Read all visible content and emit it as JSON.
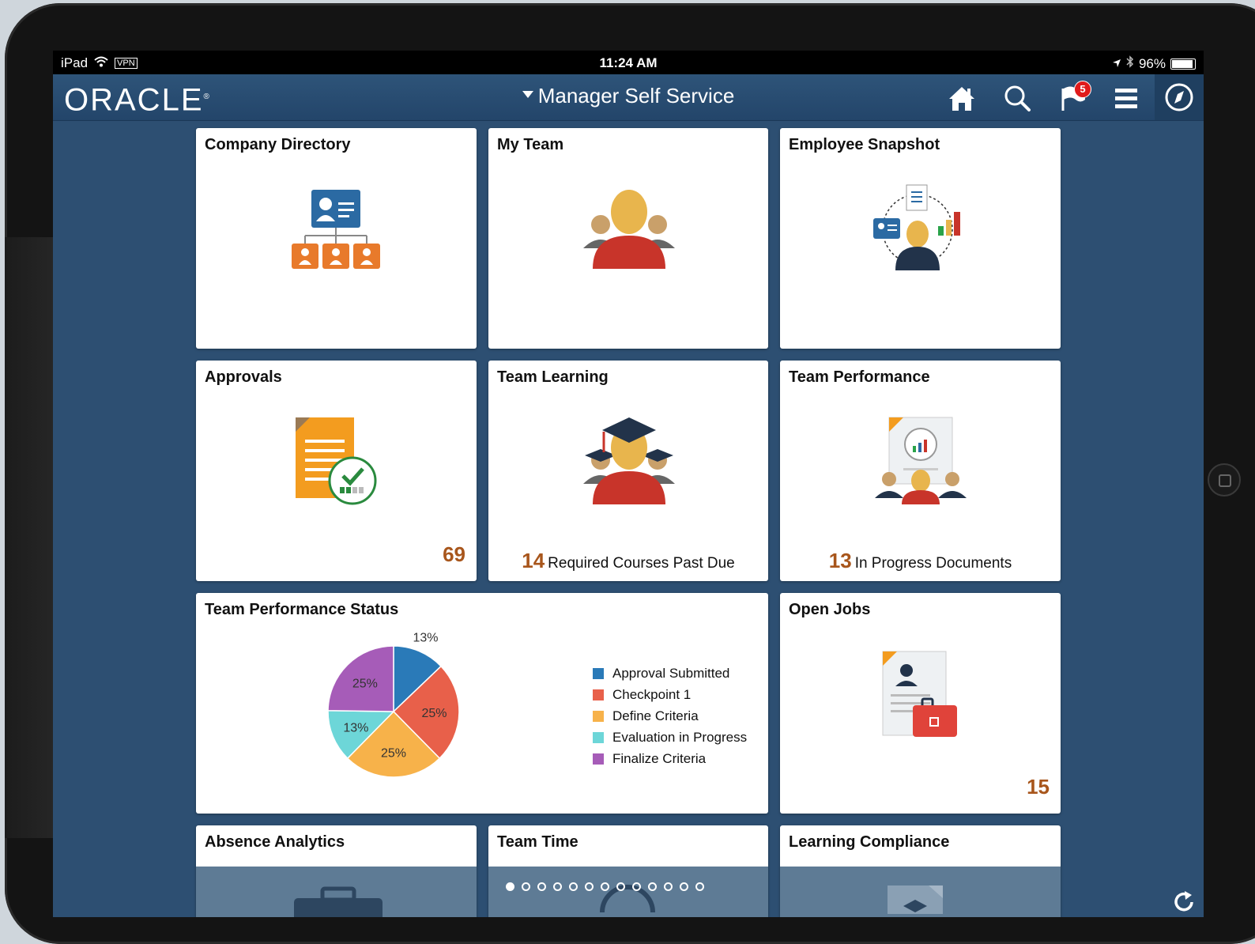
{
  "status_bar": {
    "device": "iPad",
    "vpn": "VPN",
    "time": "11:24 AM",
    "battery": "96%"
  },
  "header": {
    "logo": "ORACLE",
    "title": "Manager Self Service",
    "notification_count": "5"
  },
  "tiles": {
    "company_directory": {
      "title": "Company Directory"
    },
    "my_team": {
      "title": "My Team"
    },
    "employee_snapshot": {
      "title": "Employee Snapshot"
    },
    "approvals": {
      "title": "Approvals",
      "count": "69"
    },
    "team_learning": {
      "title": "Team Learning",
      "count": "14",
      "label": "Required Courses Past Due"
    },
    "team_performance": {
      "title": "Team Performance",
      "count": "13",
      "label": "In Progress Documents"
    },
    "team_performance_status": {
      "title": "Team Performance Status"
    },
    "open_jobs": {
      "title": "Open Jobs",
      "count": "15"
    },
    "absence_analytics": {
      "title": "Absence Analytics"
    },
    "team_time": {
      "title": "Team Time"
    },
    "learning_compliance": {
      "title": "Learning Compliance"
    }
  },
  "chart_data": {
    "type": "pie",
    "title": "Team Performance Status",
    "categories": [
      "Approval Submitted",
      "Checkpoint 1",
      "Define Criteria",
      "Evaluation in Progress",
      "Finalize Criteria"
    ],
    "values": [
      13,
      25,
      25,
      13,
      25
    ],
    "labels": [
      "13%",
      "25%",
      "25%",
      "13%",
      "25%"
    ],
    "colors": [
      "#2a7ab8",
      "#e8604a",
      "#f7b24a",
      "#6dd6d8",
      "#a65cb8"
    ],
    "legend_position": "right"
  }
}
